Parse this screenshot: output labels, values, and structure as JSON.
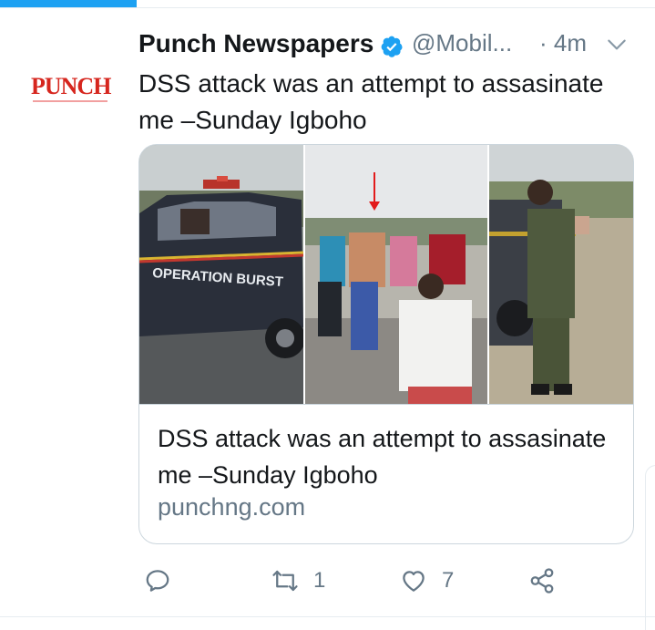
{
  "tweet": {
    "author": {
      "name": "Punch Newspapers",
      "handle": "@Mobil...",
      "avatar_text": "PUNCH",
      "verified": true
    },
    "time": "· 4m",
    "text": "DSS attack was an attempt to assasinate me –Sunday Igboho",
    "card": {
      "title": "DSS attack was an attempt to assasinate me –Sunday Igboho",
      "domain": "punchng.com",
      "vehicle_text": "OPERATION BURST"
    },
    "actions": {
      "reply_count": "",
      "retweet_count": "1",
      "like_count": "7"
    }
  },
  "colors": {
    "accent": "#1da1f2",
    "verified_badge": "#1da1f2",
    "brand_red": "#d6261e",
    "secondary_text": "#657786"
  },
  "icons": [
    "verified-badge-icon",
    "chevron-down-icon",
    "reply-icon",
    "retweet-icon",
    "like-icon",
    "share-icon"
  ]
}
